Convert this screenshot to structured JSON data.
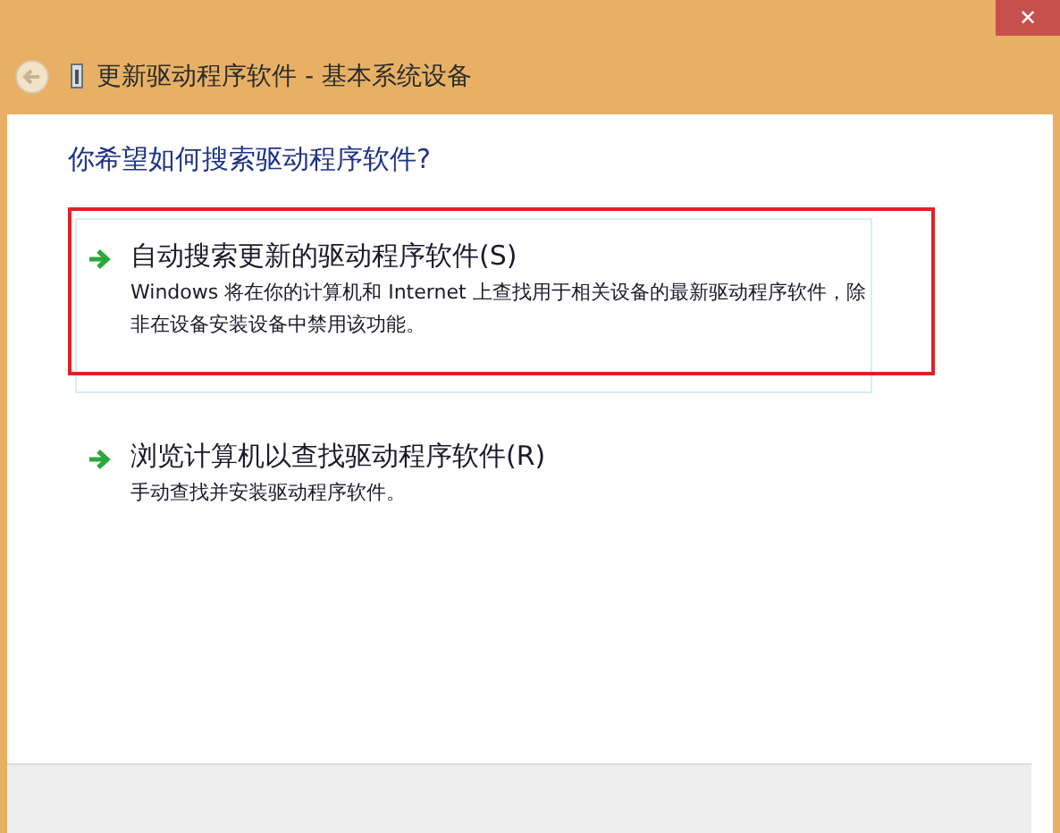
{
  "window": {
    "title": "更新驱动程序软件 - 基本系统设备",
    "close": "✕"
  },
  "heading": "你希望如何搜索驱动程序软件?",
  "options": [
    {
      "title": "自动搜索更新的驱动程序软件(S)",
      "description": "Windows 将在你的计算机和 Internet 上查找用于相关设备的最新驱动程序软件，除非在设备安装设备中禁用该功能。",
      "selected": true,
      "marked": true
    },
    {
      "title": "浏览计算机以查找驱动程序软件(R)",
      "description": "手动查找并安装驱动程序软件。",
      "selected": false,
      "marked": false
    }
  ]
}
